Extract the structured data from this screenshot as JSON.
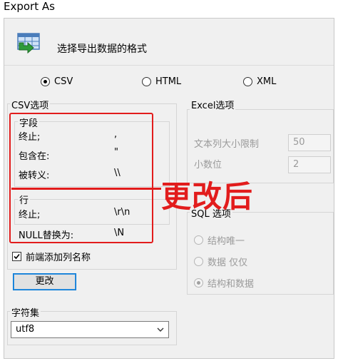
{
  "window": {
    "title": "Export As"
  },
  "header": {
    "title": "选择导出数据的格式",
    "icon": "export-table-icon"
  },
  "format": {
    "options": [
      {
        "label": "CSV",
        "selected": true
      },
      {
        "label": "HTML",
        "selected": false
      },
      {
        "label": "XML",
        "selected": false
      }
    ]
  },
  "csv_options": {
    "title": "CSV选项",
    "field": {
      "title": "字段",
      "terminator_label": "终止;",
      "terminator_value": ",",
      "enclosed_label": "包含在:",
      "enclosed_value": "\"",
      "escape_label": "被转义:",
      "escape_value": "\\\\"
    },
    "row": {
      "title": "行",
      "terminator_label": "终止;",
      "terminator_value": "\\r\\n"
    },
    "null_label": "NULL替换为:",
    "null_value": "\\N",
    "header_checkbox_label": "前端添加列名称",
    "header_checkbox_checked": true,
    "change_button": "更改"
  },
  "charset": {
    "title": "字符集",
    "value": "utf8",
    "arrow": "chevron-down-icon"
  },
  "excel_options": {
    "title": "Excel选项",
    "text_limit_label": "文本列大小限制",
    "text_limit_value": "50",
    "decimal_label": "小数位",
    "decimal_value": "2"
  },
  "annotation": {
    "text": "更改后",
    "color": "#e21c1c"
  },
  "sql_options": {
    "title": "SQL 选项",
    "options": [
      {
        "label": "结构唯一",
        "selected": false
      },
      {
        "label": "数据 仅仅",
        "selected": false
      },
      {
        "label": "结构和数据",
        "selected": true
      }
    ]
  }
}
